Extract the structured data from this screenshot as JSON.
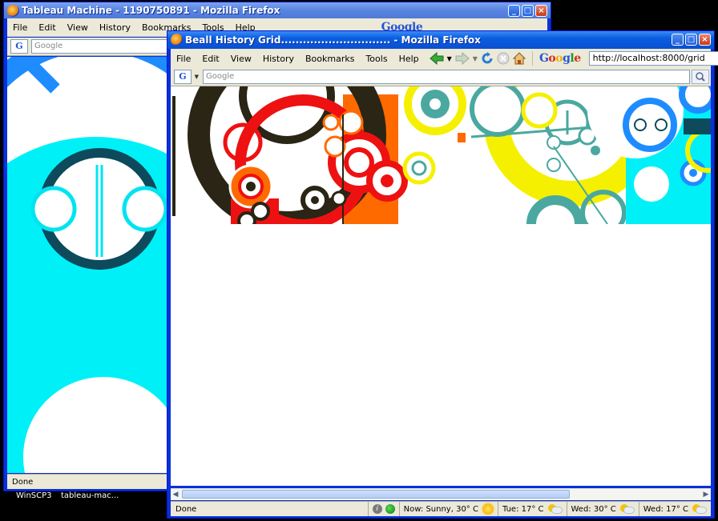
{
  "back_window": {
    "title": "Tableau Machine - 1190750891 - Mozilla Firefox",
    "menu": [
      "File",
      "Edit",
      "View",
      "History",
      "Bookmarks",
      "Tools",
      "Help"
    ],
    "search_placeholder": "Google",
    "google_logo": "Google",
    "status": "Done"
  },
  "front_window": {
    "title": "Beall History Grid.............................. - Mozilla Firefox",
    "menu": [
      "File",
      "Edit",
      "View",
      "History",
      "Bookmarks",
      "Tools",
      "Help"
    ],
    "google_logo": "Google",
    "url": "http://localhost:8000/grid",
    "search_placeholder": "Google",
    "status": "Done",
    "weather": [
      {
        "label": "Now: Sunny, 30° C",
        "icon": "sun-icon"
      },
      {
        "label": "Tue: 17° C",
        "icon": "partly-cloudy-icon"
      },
      {
        "label": "Wed: 30° C",
        "icon": "partly-cloudy-icon"
      },
      {
        "label": "Wed: 17° C",
        "icon": "partly-cloudy-icon"
      }
    ]
  },
  "taskbar": {
    "items": [
      "WinSCP3",
      "tableau-mac..."
    ]
  },
  "colors": {
    "cyan": "#00f0f8",
    "blue": "#1e8cff",
    "dark_teal": "#0c4a5c",
    "red": "#ee1111",
    "orange": "#ff6a00",
    "yellow": "#f5f000",
    "teal": "#4aa8a0",
    "dark": "#2a2514"
  }
}
